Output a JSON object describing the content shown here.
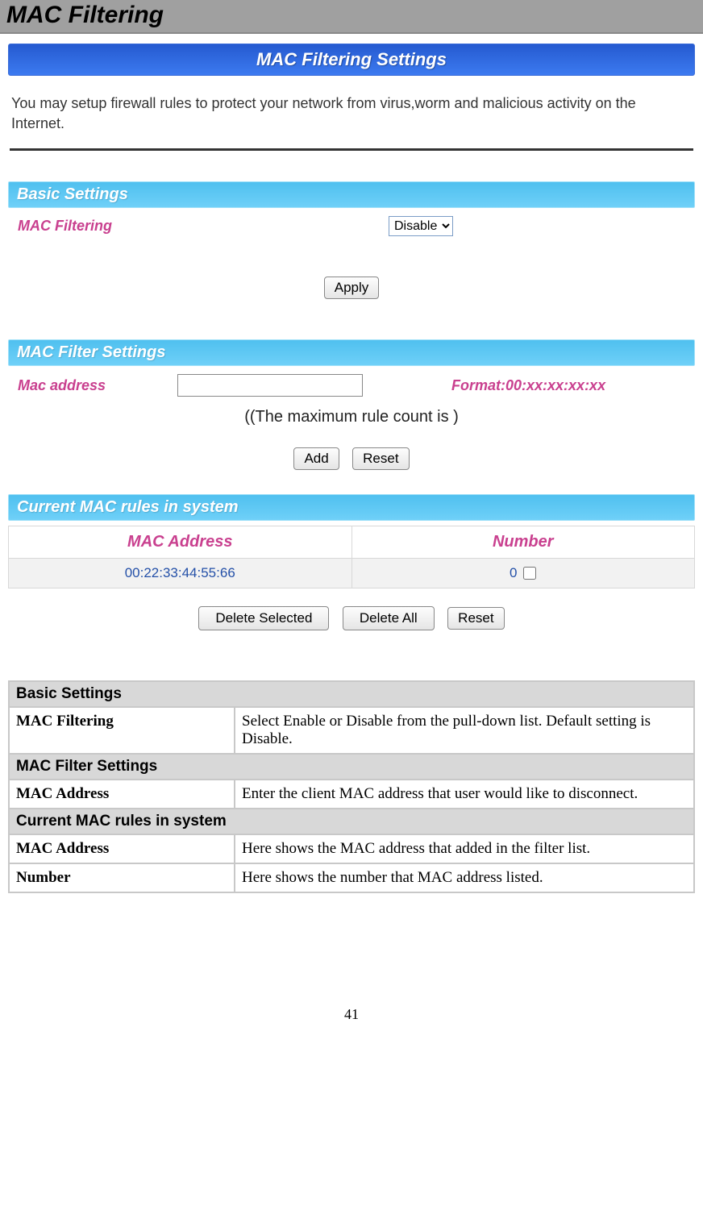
{
  "page": {
    "title": "MAC Filtering",
    "number": "41"
  },
  "panel": {
    "title": "MAC Filtering Settings",
    "intro": "You may setup firewall rules to protect your network from virus,worm and malicious activity on the Internet."
  },
  "basic": {
    "section_title": "Basic Settings",
    "mac_filtering_label": "MAC Filtering",
    "select_value": "Disable",
    "apply_label": "Apply"
  },
  "filter": {
    "section_title": "MAC Filter Settings",
    "mac_label": "Mac address",
    "mac_value": "",
    "format_label": "Format:00:xx:xx:xx:xx",
    "rule_count_text": "((The maximum rule count is )",
    "add_label": "Add",
    "reset_label": "Reset"
  },
  "current": {
    "section_title": "Current MAC rules in system",
    "col_mac": "MAC Address",
    "col_number": "Number",
    "rows": [
      {
        "mac": "00:22:33:44:55:66",
        "number": "0"
      }
    ],
    "delete_selected_label": "Delete Selected",
    "delete_all_label": "Delete All",
    "reset_label": "Reset"
  },
  "descriptions": {
    "basic_header": "Basic Settings",
    "basic_rows": [
      {
        "key": "MAC Filtering",
        "val": "Select Enable or Disable from the pull-down list. Default setting is Disable."
      }
    ],
    "filter_header": "MAC Filter Settings",
    "filter_rows": [
      {
        "key": "MAC Address",
        "val": "Enter the client MAC address that user would like to disconnect."
      }
    ],
    "current_header": "Current MAC rules in system",
    "current_rows": [
      {
        "key": "MAC Address",
        "val": "Here shows the MAC address that added in the filter list."
      },
      {
        "key": "Number",
        "val": "Here shows the number that MAC address listed."
      }
    ]
  }
}
